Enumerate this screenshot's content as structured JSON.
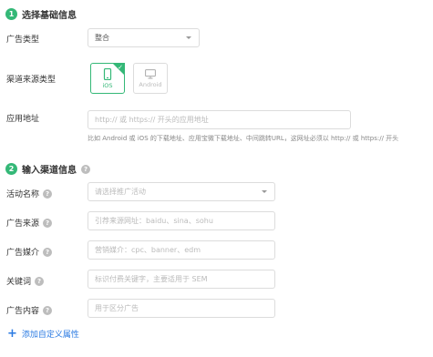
{
  "section1": {
    "step": "1",
    "title": "选择基础信息"
  },
  "ad_type": {
    "label": "广告类型",
    "value": "整合"
  },
  "channel_type": {
    "label": "渠道来源类型",
    "options": [
      {
        "name": "iOS",
        "selected": true
      },
      {
        "name": "Android",
        "selected": false
      }
    ]
  },
  "app_url": {
    "label": "应用地址",
    "placeholder": "http:// 或 https:// 开头的应用地址",
    "hint": "比如 Android 或 iOS 的下载地址、应用宝微下载地址、中间跳转URL，这网址必须以 http:// 或 https:// 开头"
  },
  "section2": {
    "step": "2",
    "title": "输入渠道信息"
  },
  "fields": [
    {
      "label": "活动名称",
      "placeholder": "请选择推广活动"
    },
    {
      "label": "广告来源",
      "placeholder": "引荐来源网址：baidu、sina、sohu"
    },
    {
      "label": "广告媒介",
      "placeholder": "营销媒介：cpc、banner、edm"
    },
    {
      "label": "关键词",
      "placeholder": "标识付费关键字，主要适用于 SEM"
    },
    {
      "label": "广告内容",
      "placeholder": "用于区分广告"
    }
  ],
  "add_custom": {
    "label": "添加自定义属性"
  },
  "colors": {
    "accent": "#34b877",
    "link": "#2a7ae2"
  },
  "icons": {
    "help": "question-circle-icon",
    "phone": "mobile-phone-icon",
    "desktop": "monitor-icon",
    "plus": "plus-icon"
  }
}
